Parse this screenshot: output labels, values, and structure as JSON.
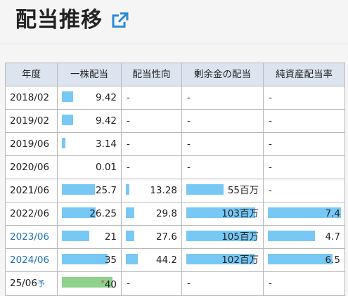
{
  "header": {
    "title": "配当推移",
    "icon": "external-link-icon"
  },
  "colors": {
    "bar": "#78c8f5",
    "forecast_bar": "#8ed28e",
    "header_bg": "#dce4ef",
    "link": "#1e6fb8",
    "star": "#e53935"
  },
  "table": {
    "columns": [
      "年度",
      "一株配当",
      "配当性向",
      "剰余金の配当",
      "純資産配当率"
    ],
    "rows": [
      {
        "year": "2018/02",
        "is_link": false,
        "dps": "9.42",
        "dps_frac": 0.22,
        "payout": "-",
        "payout_frac": null,
        "surplus": "-",
        "surplus_frac": null,
        "doe": "-",
        "doe_frac": null
      },
      {
        "year": "2019/02",
        "is_link": false,
        "dps": "9.42",
        "dps_frac": 0.22,
        "payout": "-",
        "payout_frac": null,
        "surplus": "-",
        "surplus_frac": null,
        "doe": "-",
        "doe_frac": null
      },
      {
        "year": "2019/06",
        "is_link": false,
        "dps": "3.14",
        "dps_frac": 0.07,
        "payout": "-",
        "payout_frac": null,
        "surplus": "-",
        "surplus_frac": null,
        "doe": "-",
        "doe_frac": null
      },
      {
        "year": "2020/06",
        "is_link": false,
        "dps": "0.01",
        "dps_frac": 0,
        "payout": "-",
        "payout_frac": null,
        "surplus": "-",
        "surplus_frac": null,
        "doe": "-",
        "doe_frac": null
      },
      {
        "year": "2021/06",
        "is_link": false,
        "dps": "25.7",
        "dps_frac": 0.65,
        "payout": "13.28",
        "payout_frac": 0.15,
        "surplus": "55百万",
        "surplus_frac": 0.53,
        "doe": "-",
        "doe_frac": null
      },
      {
        "year": "2022/06",
        "is_link": false,
        "dps": "26.25",
        "dps_frac": 0.66,
        "payout": "29.8",
        "payout_frac": 0.34,
        "surplus": "103百万",
        "surplus_frac": 0.98,
        "doe": "7.4",
        "doe_frac": 1.0
      },
      {
        "year": "2023/06",
        "is_link": true,
        "dps": "21",
        "dps_frac": 0.54,
        "payout": "27.6",
        "payout_frac": 0.33,
        "surplus": "105百万",
        "surplus_frac": 1.0,
        "doe": "4.7",
        "doe_frac": 0.64
      },
      {
        "year": "2024/06",
        "is_link": true,
        "dps": "35",
        "dps_frac": 0.9,
        "payout": "44.2",
        "payout_frac": 0.48,
        "surplus": "102百万",
        "surplus_frac": 0.97,
        "doe": "6.5",
        "doe_frac": 0.88
      },
      {
        "year": "25/06",
        "year_suffix": "予",
        "is_link": false,
        "forecast": true,
        "dps": "40",
        "dps_star": "*",
        "dps_frac": 1.0,
        "payout": "-",
        "payout_frac": null,
        "surplus": "-",
        "surplus_frac": null,
        "doe": "-",
        "doe_frac": null
      }
    ]
  }
}
